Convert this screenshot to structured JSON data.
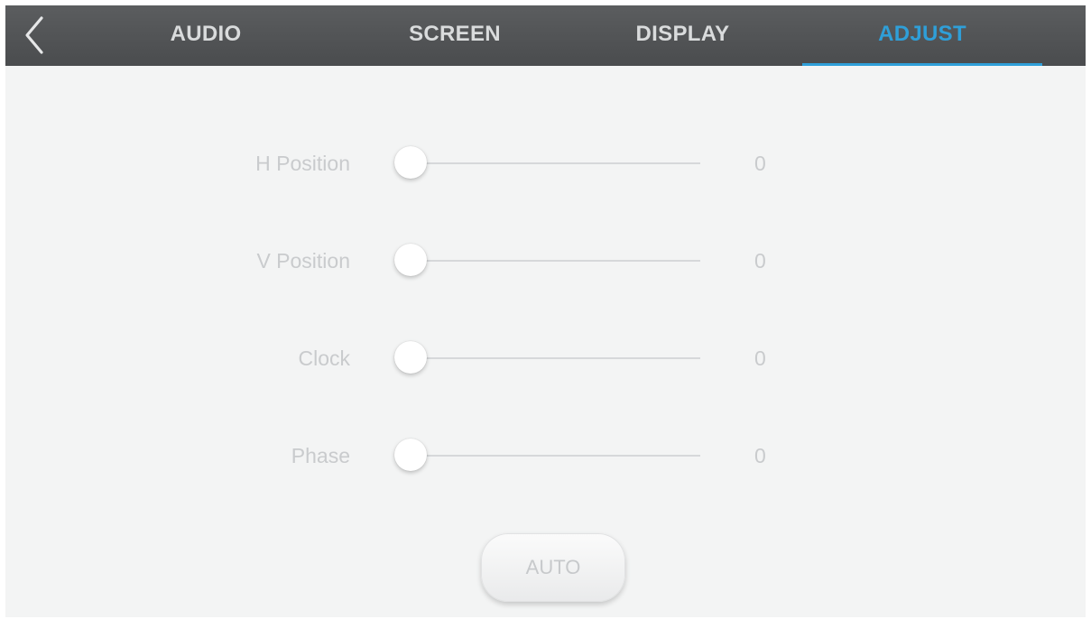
{
  "header": {
    "tabs": [
      {
        "label": "AUDIO",
        "active": false
      },
      {
        "label": "SCREEN",
        "active": false
      },
      {
        "label": "DISPLAY",
        "active": false
      },
      {
        "label": "ADJUST",
        "active": true
      }
    ],
    "back_icon": "chevron-left-icon"
  },
  "adjust": {
    "rows": [
      {
        "label": "H Position",
        "value": "0",
        "level": 0
      },
      {
        "label": "V Position",
        "value": "0",
        "level": 0
      },
      {
        "label": "Clock",
        "value": "0",
        "level": 0
      },
      {
        "label": "Phase",
        "value": "0",
        "level": 0
      }
    ],
    "auto_label": "AUTO"
  },
  "colors": {
    "header_bg": "#4f5153",
    "accent": "#2f9fd8",
    "tab_text": "#d9dbdc",
    "content_bg": "#f3f4f4",
    "disabled_text": "#c9cbcd"
  }
}
